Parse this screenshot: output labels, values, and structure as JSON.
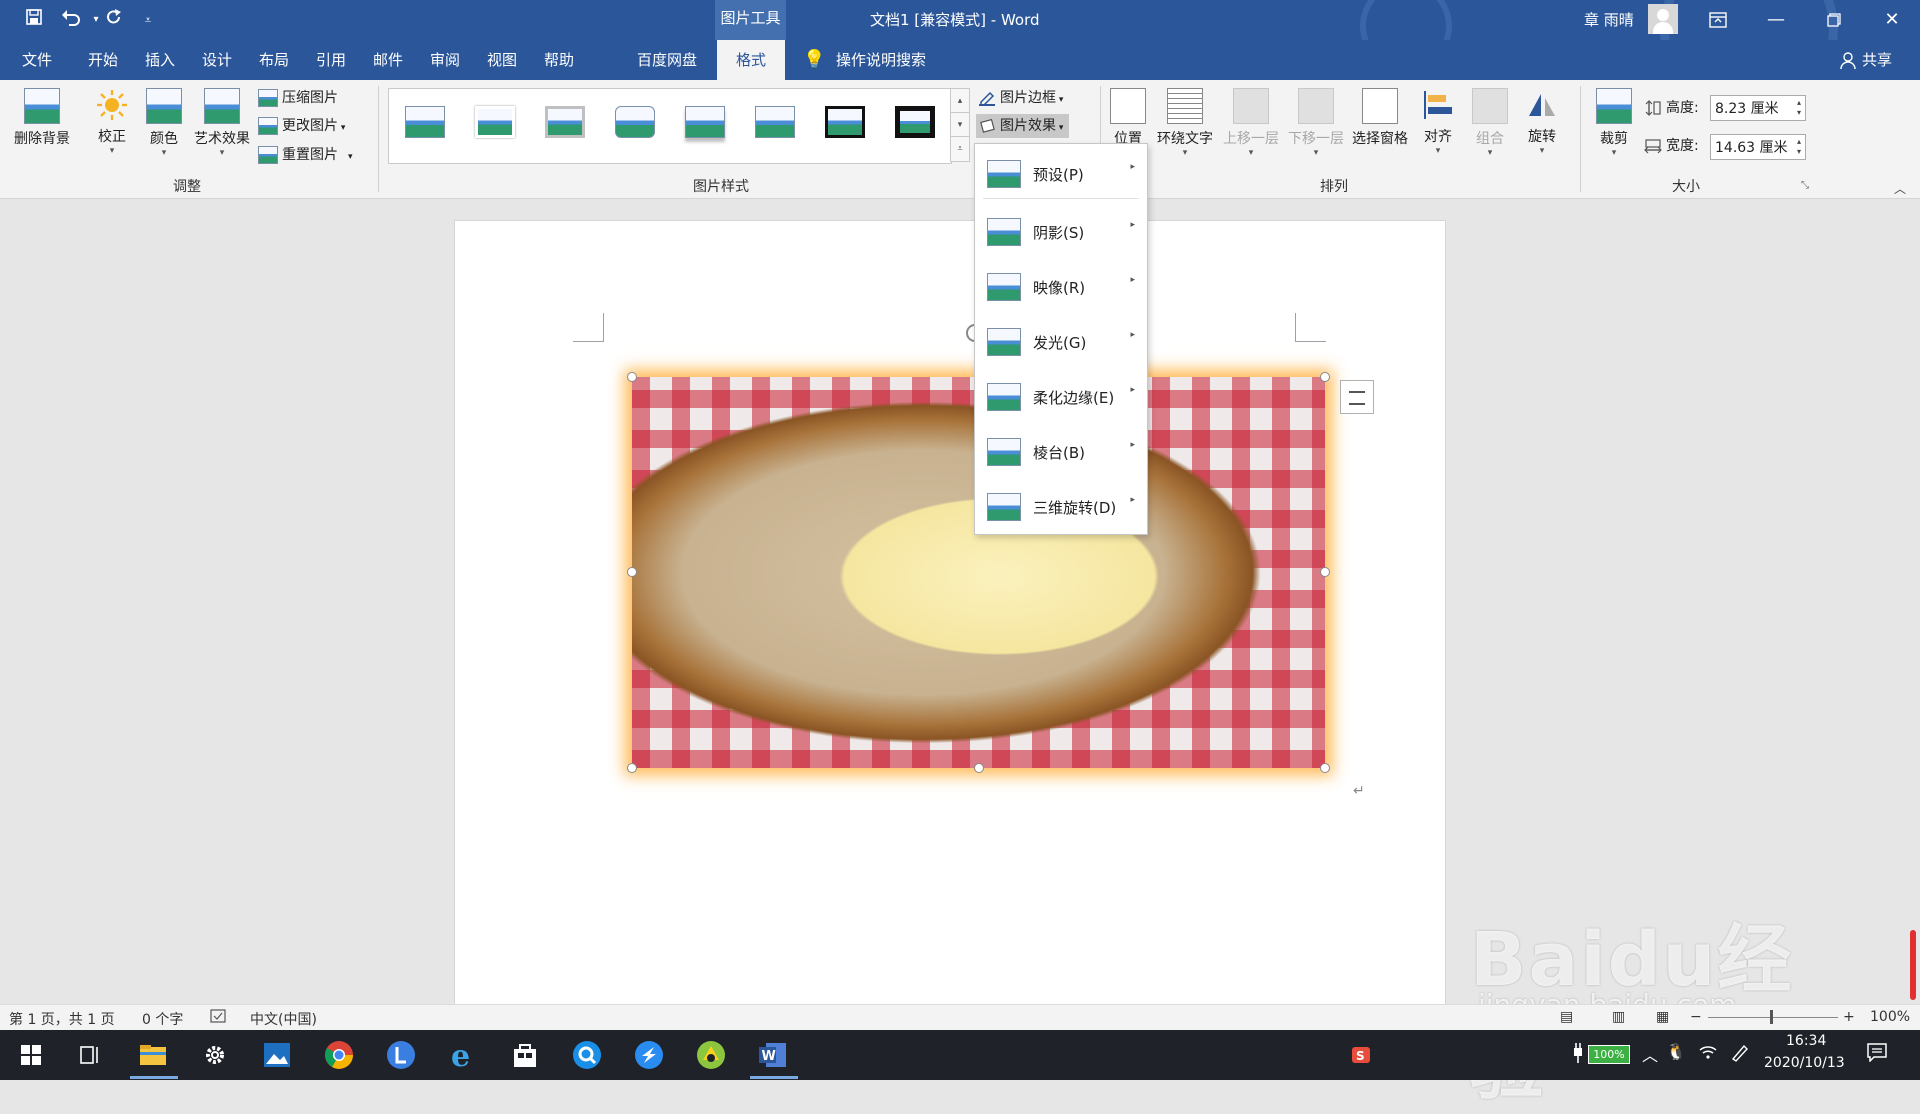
{
  "title_bar": {
    "tool_tab": "图片工具",
    "doc_title": "文档1 [兼容模式] - Word",
    "user_name": "章 雨晴",
    "qat": [
      "save-icon",
      "undo-icon",
      "redo-icon",
      "customize-icon"
    ]
  },
  "menu": {
    "items": [
      "文件",
      "开始",
      "插入",
      "设计",
      "布局",
      "引用",
      "邮件",
      "审阅",
      "视图",
      "帮助",
      "百度网盘"
    ],
    "active": "格式",
    "search": "操作说明搜索",
    "share": "共享"
  },
  "ribbon": {
    "adjust": {
      "remove_bg": "删除背景",
      "correct": "校正",
      "color": "颜色",
      "artistic": "艺术效果",
      "compress": "压缩图片",
      "change": "更改图片",
      "reset": "重置图片",
      "group_label": "调整"
    },
    "styles": {
      "group_label": "图片样式",
      "border": "图片边框",
      "effects": "图片效果"
    },
    "arrange": {
      "position": "位置",
      "wrap": "环绕文字",
      "bring_forward": "上移一层",
      "send_backward": "下移一层",
      "selection_pane": "选择窗格",
      "align": "对齐",
      "group": "组合",
      "rotate": "旋转",
      "group_label": "排列"
    },
    "size": {
      "crop": "裁剪",
      "height_label": "高度:",
      "height_value": "8.23 厘米",
      "width_label": "宽度:",
      "width_value": "14.63 厘米",
      "group_label": "大小"
    }
  },
  "effects_menu": {
    "items": [
      {
        "label": "预设(P)"
      },
      {
        "label": "阴影(S)"
      },
      {
        "label": "映像(R)"
      },
      {
        "label": "发光(G)"
      },
      {
        "label": "柔化边缘(E)"
      },
      {
        "label": "棱台(B)"
      },
      {
        "label": "三维旋转(D)"
      }
    ]
  },
  "status_bar": {
    "page": "第 1 页，共 1 页",
    "words": "0 个字",
    "language": "中文(中国)",
    "zoom": "100%"
  },
  "taskbar": {
    "battery": "100%",
    "time": "16:34",
    "date": "2020/10/13"
  },
  "watermark": {
    "brand": "Baidu经验",
    "url": "jingyan.baidu.com"
  },
  "colors": {
    "word_blue": "#2b579a",
    "ribbon_bg": "#f3f3f3",
    "glow": "#ffb446"
  }
}
